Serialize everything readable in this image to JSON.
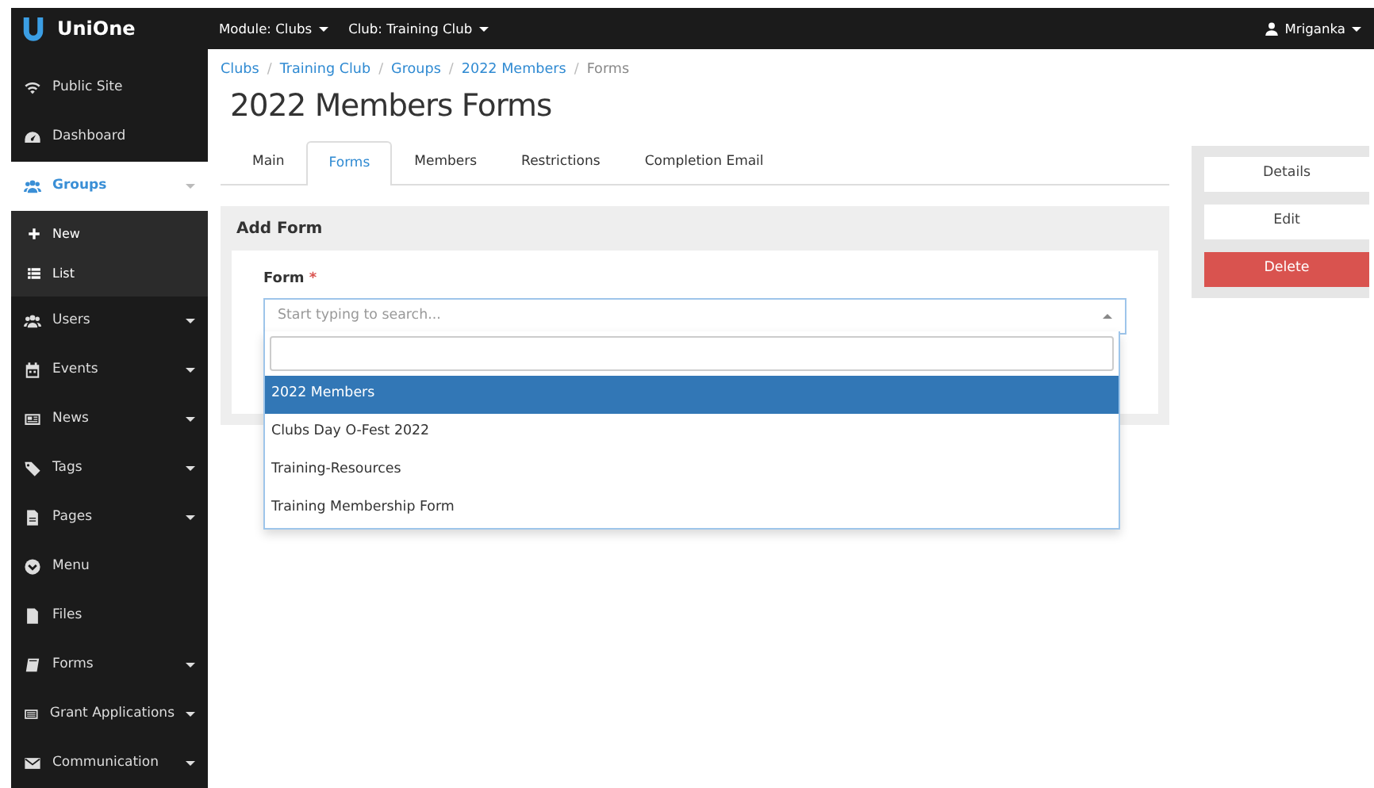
{
  "brand": "UniOne",
  "topnav": {
    "menus": [
      {
        "label": "Module: Clubs"
      },
      {
        "label": "Club: Training Club"
      }
    ],
    "user": "Mriganka"
  },
  "sidebar": {
    "items": [
      {
        "label": "Public Site",
        "kind": "link",
        "selected": false
      },
      {
        "label": "Dashboard",
        "kind": "link",
        "selected": false
      },
      {
        "label": "Groups",
        "kind": "submenu",
        "selected": true,
        "expanded": true,
        "children": [
          {
            "label": "New"
          },
          {
            "label": "List"
          }
        ]
      },
      {
        "label": "Users",
        "kind": "submenu",
        "selected": false,
        "expanded": false
      },
      {
        "label": "Events",
        "kind": "submenu",
        "selected": false,
        "expanded": false
      },
      {
        "label": "News",
        "kind": "submenu",
        "selected": false,
        "expanded": false
      },
      {
        "label": "Tags",
        "kind": "submenu",
        "selected": false,
        "expanded": false
      },
      {
        "label": "Pages",
        "kind": "submenu",
        "selected": false,
        "expanded": false
      },
      {
        "label": "Menu",
        "kind": "link",
        "selected": false
      },
      {
        "label": "Files",
        "kind": "link",
        "selected": false
      },
      {
        "label": "Forms",
        "kind": "submenu",
        "selected": false,
        "expanded": false
      },
      {
        "label": "Grant Applications",
        "kind": "submenu",
        "selected": false,
        "expanded": false
      },
      {
        "label": "Communication",
        "kind": "submenu",
        "selected": false,
        "expanded": false
      }
    ]
  },
  "breadcrumb": [
    {
      "label": "Clubs",
      "separator": "/"
    },
    {
      "label": "Training Club",
      "separator": "/"
    },
    {
      "label": "Groups",
      "separator": "/"
    },
    {
      "label": "2022 Members",
      "separator": "/"
    },
    {
      "label": "Forms"
    }
  ],
  "title": "2022 Members Forms",
  "tabs": [
    {
      "label": "Main",
      "selected": false
    },
    {
      "label": "Forms",
      "selected": true
    },
    {
      "label": "Members",
      "selected": false
    },
    {
      "label": "Restrictions",
      "selected": false
    },
    {
      "label": "Completion Email",
      "selected": false
    }
  ],
  "panel": {
    "title": "Add Form",
    "field": {
      "label": "Form",
      "required_mark": "*",
      "placeholder": "Start typing to search...",
      "expanded": true,
      "options": [
        {
          "label": "2022 Members",
          "selected": true
        },
        {
          "label": "Clubs Day O-Fest 2022",
          "selected": false
        },
        {
          "label": "Training-Resources",
          "selected": false
        },
        {
          "label": "Training Membership Form",
          "selected": false
        }
      ]
    }
  },
  "actions": [
    {
      "label": "Details",
      "kind": "default"
    },
    {
      "label": "Edit",
      "kind": "default"
    },
    {
      "label": "Delete",
      "kind": "danger"
    }
  ]
}
